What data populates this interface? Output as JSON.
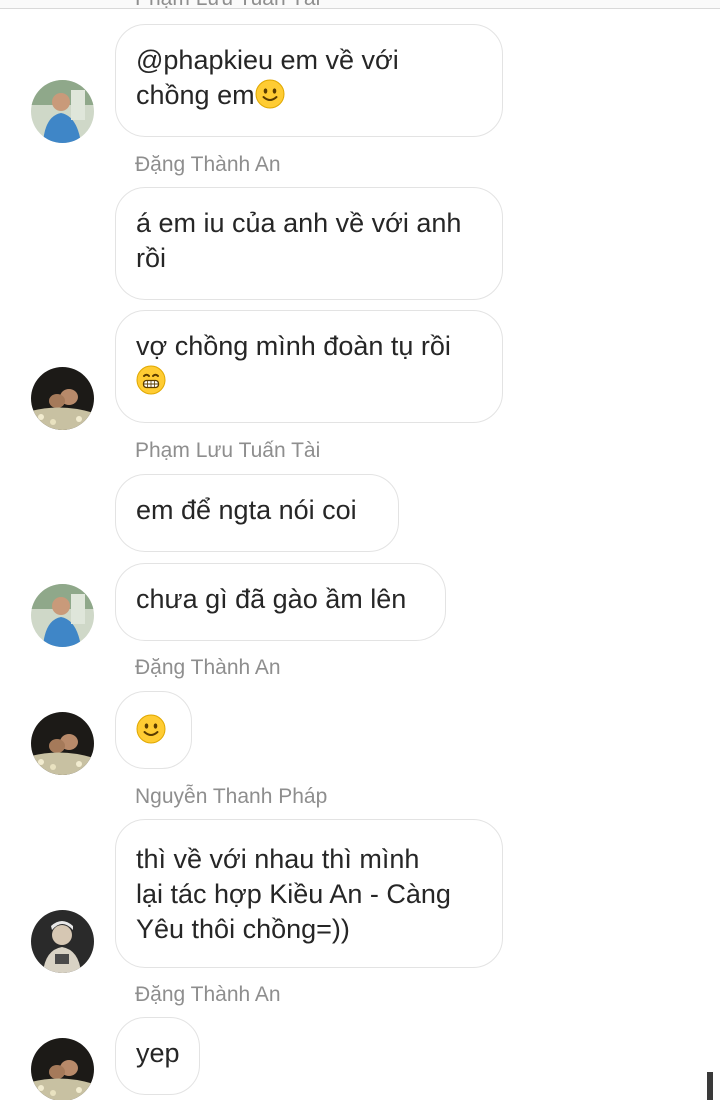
{
  "thread": {
    "top_cut_sender": "Phạm Lưu Tuấn Tài",
    "messages": [
      {
        "sender": "",
        "text": "@phapkieu em về với\nchồng em",
        "emoji": "slight-smile-icon",
        "avatar": "avatar-blue-shirt"
      },
      {
        "sender": "Đặng Thành An",
        "text": "á em iu của anh về với anh\nrồi",
        "emoji": "",
        "avatar": ""
      },
      {
        "sender": "",
        "text": "vợ chồng mình đoàn tụ rồi\n",
        "emoji": "grin-icon",
        "avatar": "avatar-dark-couple"
      },
      {
        "sender": "Phạm Lưu Tuấn Tài",
        "text": "em để ngta nói coi",
        "emoji": "",
        "avatar": ""
      },
      {
        "sender": "",
        "text": "chưa gì đã gào ầm lên",
        "emoji": "",
        "avatar": "avatar-blue-shirt"
      },
      {
        "sender": "Đặng Thành An",
        "text": "",
        "emoji": "slight-smile-icon",
        "avatar": "avatar-dark-couple"
      },
      {
        "sender": "Nguyễn Thanh Pháp",
        "text": "thì về với nhau thì mình\nlại tác hợp Kiều An - Càng\nYêu thôi chồng=))",
        "emoji": "",
        "avatar": "avatar-grey-portrait"
      },
      {
        "sender": "Đặng Thành An",
        "text": "yep",
        "emoji": "",
        "avatar": "avatar-dark-couple"
      }
    ]
  },
  "colors": {
    "sender_name": "#8e8e8e",
    "message_text": "#262626",
    "bubble_border": "#e3e3e3",
    "emoji_yellow": "#ffcc33"
  }
}
